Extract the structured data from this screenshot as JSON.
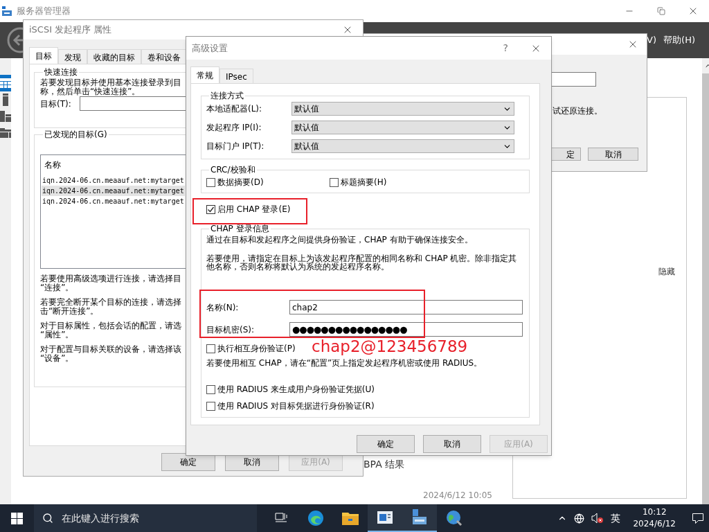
{
  "app": {
    "title": "服务器管理器",
    "menu": [
      "V)",
      "帮助(H)"
    ],
    "sidebar": [
      {
        "selected": true
      },
      {
        "selected": false
      },
      {
        "selected": false
      },
      {
        "selected": false
      }
    ],
    "side_panel": {
      "link": "隐藏"
    },
    "tile": {
      "title": "BPA 结果",
      "timestamp": "2024/6/12 10:05"
    }
  },
  "reconnect_dialog": {
    "message": "试还原连接。",
    "buttons": [
      {
        "label": "定",
        "disabled": false
      },
      {
        "label": "取消",
        "disabled": false
      }
    ]
  },
  "iscsi_dialog": {
    "title": "iSCSI 发起程序 属性",
    "tabs": [
      {
        "label": "目标",
        "selected": true
      },
      {
        "label": "发现",
        "selected": false
      },
      {
        "label": "收藏的目标",
        "selected": false
      },
      {
        "label": "卷和设备",
        "selected": false
      }
    ],
    "quick_connect": {
      "legend": "快速连接",
      "lines": [
        "若要发现目标并使用基本连接登录到目",
        "称，然后单击“快速连接”。"
      ],
      "target_label": "目标(T):"
    },
    "discovered": {
      "legend": "已发现的目标(G)",
      "column": "名称",
      "rows": [
        {
          "name": "iqn.2024-06.cn.meaauf.net:mytarget",
          "selected": false
        },
        {
          "name": "iqn.2024-06.cn.meaauf.net:mytarget",
          "selected": true
        },
        {
          "name": "iqn.2024-06.cn.meaauf.net:mytarget",
          "selected": false
        }
      ]
    },
    "help": [
      [
        "若要使用高级选项进行连接，请选择目",
        "“连接”。"
      ],
      [
        "若要完全断开某个目标的连接，请选择",
        "击“断开连接”。"
      ],
      [
        "对于目标属性，包括会话的配置，请选",
        "“属性”。"
      ],
      [
        "对于配置与目标关联的设备，请选择该",
        "“设备”。"
      ]
    ],
    "buttons": [
      {
        "label": "确定",
        "disabled": false
      },
      {
        "label": "取消",
        "disabled": false
      },
      {
        "label": "应用(A)",
        "disabled": true
      }
    ]
  },
  "advanced_dialog": {
    "title": "高级设置",
    "help_glyph": "?",
    "tabs": [
      {
        "label": "常规",
        "selected": true
      },
      {
        "label": "IPsec",
        "selected": false
      }
    ],
    "connection": {
      "legend": "连接方式",
      "rows": [
        {
          "label": "本地适配器(L):",
          "value": "默认值"
        },
        {
          "label": "发起程序 IP(I):",
          "value": "默认值"
        },
        {
          "label": "目标门户 IP(T):",
          "value": "默认值"
        }
      ]
    },
    "crc": {
      "legend": "CRC/校验和",
      "options": [
        {
          "label": "数据摘要(D)",
          "checked": false
        },
        {
          "label": "标题摘要(H)",
          "checked": false
        }
      ]
    },
    "enable_chap": {
      "label": "启用 CHAP 登录(E)",
      "checked": true
    },
    "chap": {
      "legend": "CHAP 登录信息",
      "intro": "通过在目标和发起程序之间提供身份验证，CHAP 有助于确保连接安全。",
      "usage": "若要使用，请指定在目标上为该发起程序配置的相同名称和 CHAP 机密。除非指定其他名称，否则名称将默认为系统的发起程序名称。",
      "fields": [
        {
          "label": "名称(N):",
          "value": "chap2"
        },
        {
          "label": "目标机密(S):",
          "value": "●●●●●●●●●●●●●●●●"
        }
      ],
      "mutual": {
        "label": "执行相互身份验证(P)",
        "checked": false
      },
      "mutual_note": "若要使用相互 CHAP，请在“配置”页上指定发起程序机密或使用 RADIUS。",
      "radius": [
        {
          "label": "使用 RADIUS 来生成用户身份验证凭据(U)",
          "checked": false
        },
        {
          "label": "使用 RADIUS 对目标凭据进行身份验证(R)",
          "checked": false
        }
      ]
    },
    "buttons": [
      {
        "label": "确定",
        "disabled": false
      },
      {
        "label": "取消",
        "disabled": false
      },
      {
        "label": "应用(A)",
        "disabled": true
      }
    ]
  },
  "annotation": {
    "text": "chap2@123456789"
  },
  "taskbar": {
    "search_placeholder": "在此键入进行搜索",
    "ime": "英",
    "time": "10:12",
    "date": "2024/6/12"
  }
}
